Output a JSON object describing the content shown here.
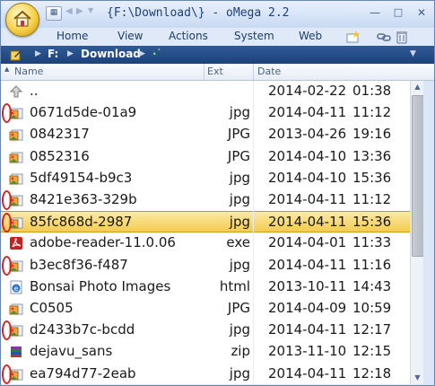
{
  "window": {
    "title": "{F:\\Download\\} - oMega 2.2"
  },
  "quick_access": {
    "toolbar_icon": "grid-icon",
    "back_icon": "back-arrow-icon",
    "forward_icon": "forward-arrow-icon"
  },
  "menu": {
    "items": [
      "Home",
      "View",
      "Actions",
      "System",
      "Web"
    ]
  },
  "address": {
    "drive": "F:",
    "folder": "Download",
    "extra": "·˙"
  },
  "columns": {
    "name": "Name",
    "ext": "Ext",
    "date": "Date"
  },
  "files": [
    {
      "name": "..",
      "ext": "",
      "date": "2014-02-22",
      "time": "01:38",
      "icon": "up-folder-icon"
    },
    {
      "name": "0671d5de-01a9",
      "ext": "jpg",
      "date": "2014-04-11",
      "time": "11:12",
      "icon": "image-file-icon"
    },
    {
      "name": "0842317",
      "ext": "JPG",
      "date": "2013-04-26",
      "time": "19:16",
      "icon": "image-file-icon"
    },
    {
      "name": "0852316",
      "ext": "JPG",
      "date": "2014-04-10",
      "time": "13:36",
      "icon": "image-file-icon"
    },
    {
      "name": "5df49154-b9c3",
      "ext": "jpg",
      "date": "2014-04-10",
      "time": "15:36",
      "icon": "image-file-icon"
    },
    {
      "name": "8421e363-329b",
      "ext": "jpg",
      "date": "2014-04-11",
      "time": "11:12",
      "icon": "image-file-icon"
    },
    {
      "name": "85fc868d-2987",
      "ext": "jpg",
      "date": "2014-04-11",
      "time": "15:36",
      "icon": "image-file-icon"
    },
    {
      "name": "adobe-reader-11.0.06",
      "ext": "exe",
      "date": "2014-04-01",
      "time": "11:33",
      "icon": "pdf-app-icon"
    },
    {
      "name": "b3ec8f36-f487",
      "ext": "jpg",
      "date": "2014-04-11",
      "time": "11:16",
      "icon": "image-file-icon"
    },
    {
      "name": "Bonsai Photo Images",
      "ext": "html",
      "date": "2013-10-11",
      "time": "14:43",
      "icon": "html-file-icon"
    },
    {
      "name": "C0505",
      "ext": "JPG",
      "date": "2014-04-09",
      "time": "10:59",
      "icon": "image-file-icon"
    },
    {
      "name": "d2433b7c-bcdd",
      "ext": "jpg",
      "date": "2014-04-11",
      "time": "12:17",
      "icon": "image-file-icon"
    },
    {
      "name": "dejavu_sans",
      "ext": "zip",
      "date": "2013-11-10",
      "time": "12:15",
      "icon": "archive-file-icon"
    },
    {
      "name": "ea794d77-2eab",
      "ext": "jpg",
      "date": "2014-04-11",
      "time": "12:18",
      "icon": "image-file-icon"
    }
  ],
  "selected_row": 6,
  "highlighted_rows": [
    1,
    5,
    6,
    8,
    11,
    13
  ],
  "colors": {
    "title_text": "#1e3f75",
    "address_bar": "#1d4279",
    "selection": "#f4cc4e",
    "annotation": "#d42222"
  }
}
